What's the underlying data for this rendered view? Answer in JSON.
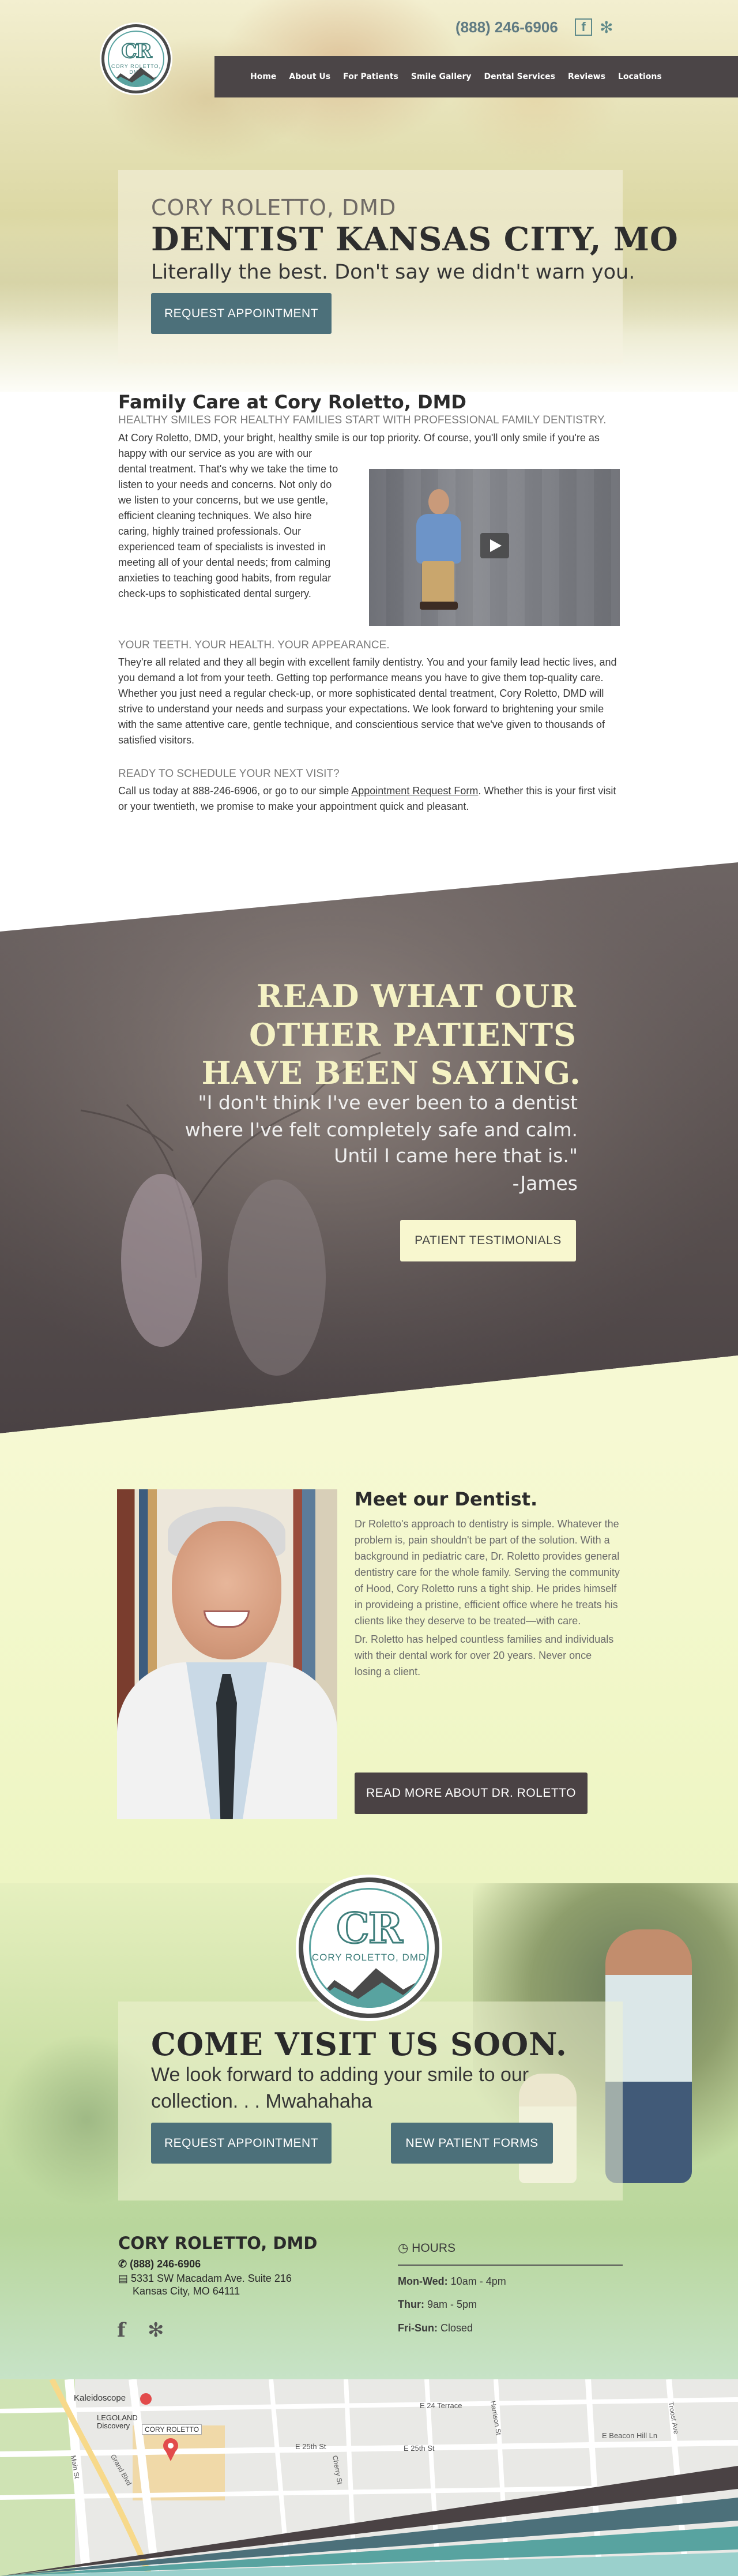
{
  "header": {
    "phone": "(888) 246-6906",
    "facebook_icon": "facebook-icon",
    "yelp_icon": "yelp-icon",
    "logo_text": "CR",
    "logo_name": "CORY ROLETTO, DMD"
  },
  "nav": {
    "items": [
      "Home",
      "About Us",
      "For Patients",
      "Smile Gallery",
      "Dental Services",
      "Reviews",
      "Locations"
    ]
  },
  "hero": {
    "name": "CORY ROLETTO, DMD",
    "title": "DENTIST KANSAS CITY, MO",
    "tagline": "Literally the best. Don't say we didn't warn you.",
    "button": "REQUEST APPOINTMENT"
  },
  "family": {
    "title": "Family Care at Cory Roletto, DMD",
    "subtitle": "HEALTHY SMILES FOR HEALTHY FAMILIES START WITH PROFESSIONAL FAMILY DENTISTRY.",
    "p1": "At Cory Roletto, DMD, your bright, healthy smile is our top priority. Of course, you'll only smile if you're as happy with our service as you are with our",
    "p2": "dental treatment. That's why we take the time to listen to your needs and concerns. Not only do we listen to your concerns, but we use gentle, efficient cleaning techniques. We also hire caring, highly trained professionals. Our experienced team of specialists is invested in meeting all of your dental needs; from calming anxieties to teaching good habits, from regular check-ups to sophisticated dental surgery.",
    "video_play_icon": "play-icon"
  },
  "teeth": {
    "title": "YOUR TEETH. YOUR HEALTH. YOUR APPEARANCE.",
    "text": "They're all related and they all begin with excellent family dentistry. You and your family lead hectic lives, and you demand a lot from your teeth. Getting top performance means you have to give them top-quality care. Whether you just need a regular check-up, or more sophisticated dental treatment, Cory Roletto, DMD will strive to understand your needs and surpass your expectations. We look forward to brightening your smile with the same attentive care, gentle technique, and conscientious service that we've given to thousands of satisfied visitors."
  },
  "ready": {
    "title": "READY TO SCHEDULE YOUR NEXT VISIT?",
    "text_before": "Call us today at 888-246-6906, or go to our simple ",
    "link": "Appointment Request Form",
    "text_after": ". Whether this is your first visit or your twentieth, we promise to make your appointment quick and pleasant."
  },
  "testimonials": {
    "h1": "READ WHAT OUR",
    "h2": "OTHER PATIENTS",
    "h3": "HAVE BEEN SAYING.",
    "q1": "\"I don't think I've ever been to a dentist",
    "q2": "where I've felt completely safe and calm.",
    "q3": "Until I came here that is.\"",
    "q4": "-James",
    "button": "PATIENT TESTIMONIALS"
  },
  "meet": {
    "title": "Meet our Dentist.",
    "p1": "Dr Roletto's approach to dentistry is simple. Whatever the problem is, pain shouldn't be part of the solution. With a background in pediatric care, Dr. Roletto provides general dentistry care for the whole family. Serving the community of Hood, Cory Roletto runs a tight ship. He prides himself in provideing a pristine, efficient office where he treats his clients like they deserve to be treated—with care.",
    "p2": "Dr. Roletto has helped countless families and individuals with their dental work for over 20 years. Never once losing a client.",
    "button": "READ MORE ABOUT DR. ROLETTO"
  },
  "visit": {
    "title": "COME VISIT US SOON.",
    "sub1": "We look forward to adding your smile to our",
    "sub2": "collection. . . Mwahahaha",
    "button1": "REQUEST APPOINTMENT",
    "button2": "NEW PATIENT FORMS"
  },
  "footer": {
    "name": "CORY ROLETTO, DMD",
    "phone": "(888) 246-6906",
    "address1": "5331 SW Macadam Ave. Suite 216",
    "address2": "Kansas City, MO 64111",
    "hours_title": "HOURS",
    "hours": [
      {
        "days": "Mon-Wed:",
        "time": "10am - 4pm"
      },
      {
        "days": "Thur:",
        "time": "9am - 5pm"
      },
      {
        "days": "Fri-Sun:",
        "time": "Closed"
      }
    ]
  },
  "map": {
    "labels": [
      "Kaleidoscope",
      "LEGOLAND Discovery",
      "CORY ROLETTO",
      "E 24 Terrace",
      "E 25th St",
      "E 25th St",
      "E Beacon Hill Ln",
      "Cherry St",
      "Harrison St",
      "Troost Ave",
      "Grand Blvd",
      "Main St"
    ]
  },
  "colors": {
    "nav_bg": "#4b4547",
    "button_teal": "#4c707a",
    "testimonial_bg": "#4a4244",
    "cream": "#f8f7cf"
  }
}
